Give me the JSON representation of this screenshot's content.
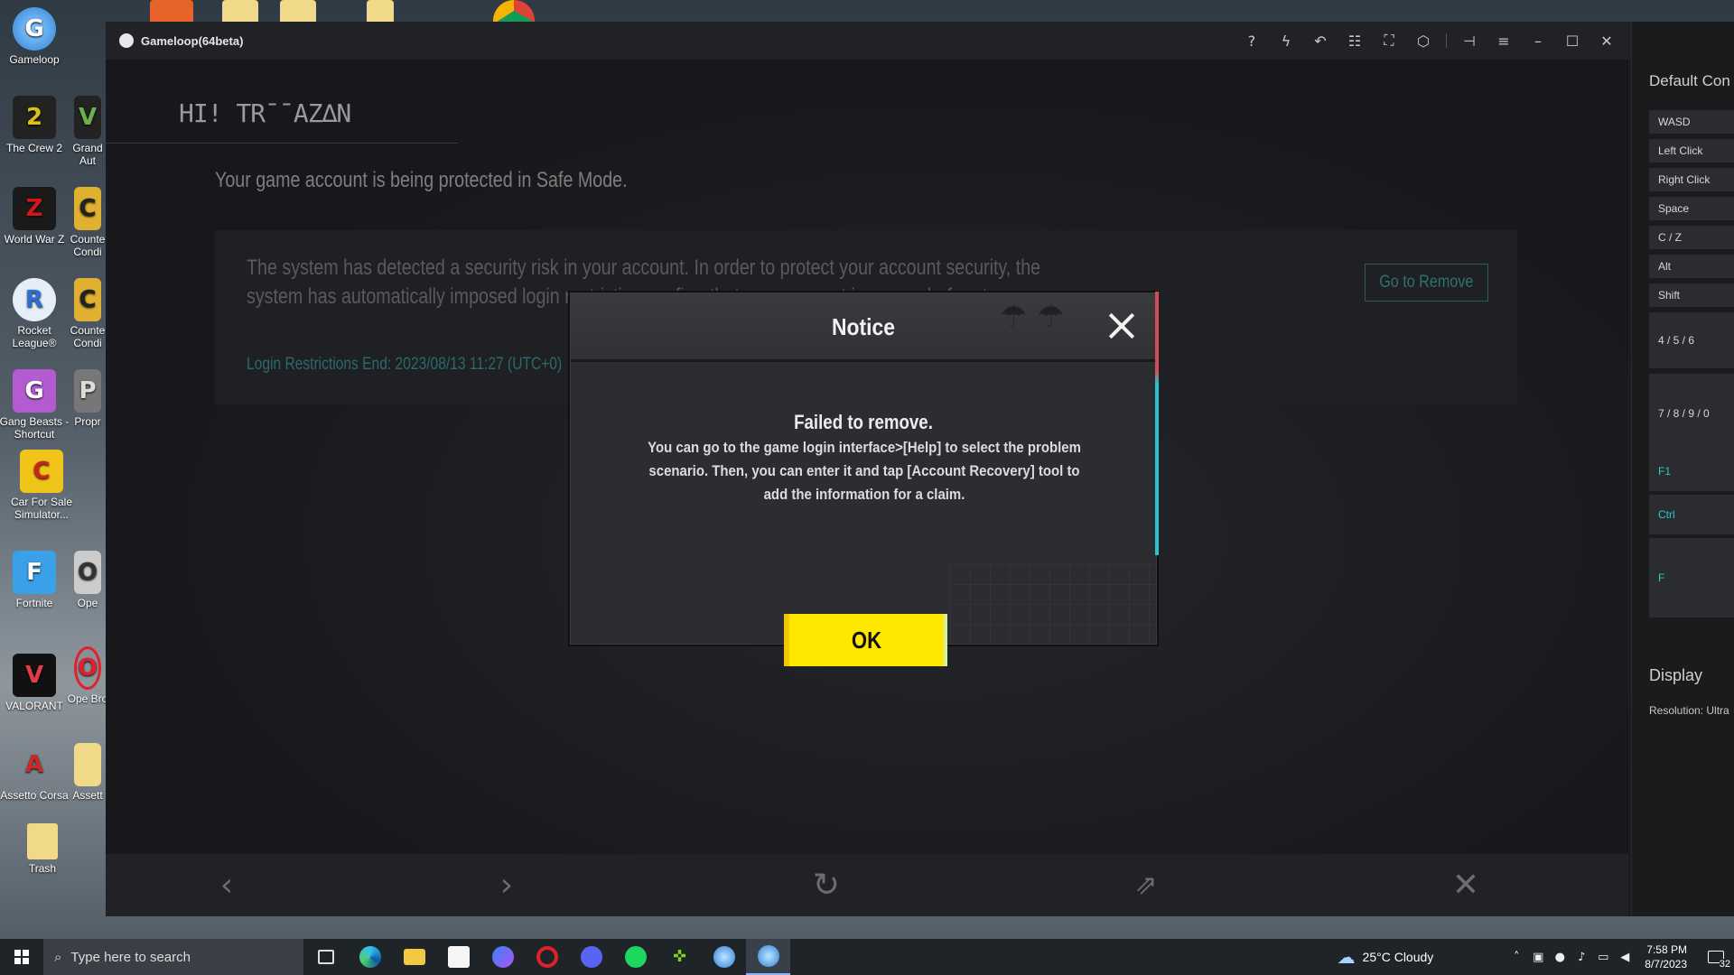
{
  "desktop": {
    "icons": [
      {
        "label": "Gameloop",
        "glyph": "G",
        "color": "#2f7fd8"
      },
      {
        "label": "The Crew 2",
        "glyph": "2",
        "color": "#d9c21a"
      },
      {
        "label": "World War Z",
        "glyph": "Z",
        "color": "#b01010"
      },
      {
        "label": "Rocket League®",
        "glyph": "R",
        "color": "#2b6ed9"
      },
      {
        "label": "Gang Beasts - Shortcut",
        "glyph": "G",
        "color": "#b35bd1"
      },
      {
        "label": "Car For Sale Simulator...",
        "glyph": "C",
        "color": "#d14b2a"
      },
      {
        "label": "Fortnite",
        "glyph": "F",
        "color": "#3aa0e8"
      },
      {
        "label": "VALORANT",
        "glyph": "V",
        "color": "#e03c4a"
      },
      {
        "label": "Assetto Corsa",
        "glyph": "A",
        "color": "#c82a2a"
      },
      {
        "label": "Trash",
        "glyph": "",
        "color": "#f1d98a"
      }
    ],
    "icons_col2": [
      {
        "label": "Grand Aut",
        "glyph": "V"
      },
      {
        "label": "Counte Condi",
        "glyph": "C"
      },
      {
        "label": "Counte Condi",
        "glyph": "C"
      },
      {
        "label": "Propr",
        "glyph": "P"
      },
      {
        "label": "Ope",
        "glyph": "O"
      },
      {
        "label": "Ope Bro",
        "glyph": "O"
      },
      {
        "label": "Assett",
        "glyph": ""
      }
    ]
  },
  "window": {
    "title": "Gameloop(64beta)",
    "toolbar_icons": [
      "help-icon",
      "flash-icon",
      "undo-icon",
      "grid-icon",
      "fullscreen-icon",
      "settings-icon",
      "pin-icon",
      "menu-icon",
      "minimize-icon",
      "maximize-icon",
      "close-icon"
    ]
  },
  "game": {
    "greeting": "HI! TR¯¯AZ∆N",
    "safe_mode_title": "Your game account is being protected in Safe Mode.",
    "info_text": "The system has detected a security risk in your account. In order to protect your account security, the system has automatically imposed login restriction                                                                  confirm that your account is secure before tapp",
    "restriction_end": "Login Restrictions End: 2023/08/13 11:27 (UTC+0)",
    "go_to_remove": "Go to Remove"
  },
  "dialog": {
    "title": "Notice",
    "subtitle": "Failed to remove.",
    "body": "You can go to the game login interface>[Help] to select the problem scenario. Then, you can enter it and tap [Account Recovery] tool to add the information for a claim.",
    "ok_label": "OK"
  },
  "bottom_nav": [
    "back-icon",
    "forward-icon",
    "refresh-icon",
    "share-icon",
    "close-icon"
  ],
  "side_panel": {
    "heading": "Default Con",
    "keys": [
      "WASD",
      "Left Click",
      "Right Click",
      "Space",
      "C / Z",
      "Alt",
      "Shift",
      "4 / 5 / 6",
      "7 / 8 / 9 / 0",
      "F1",
      "Ctrl",
      "F"
    ],
    "display_heading": "Display",
    "resolution": "Resolution: Ultra"
  },
  "taskbar": {
    "search_placeholder": "Type here to search",
    "weather": "25°C  Cloudy",
    "time": "7:58 PM",
    "date": "8/7/2023",
    "notifications": "32"
  }
}
